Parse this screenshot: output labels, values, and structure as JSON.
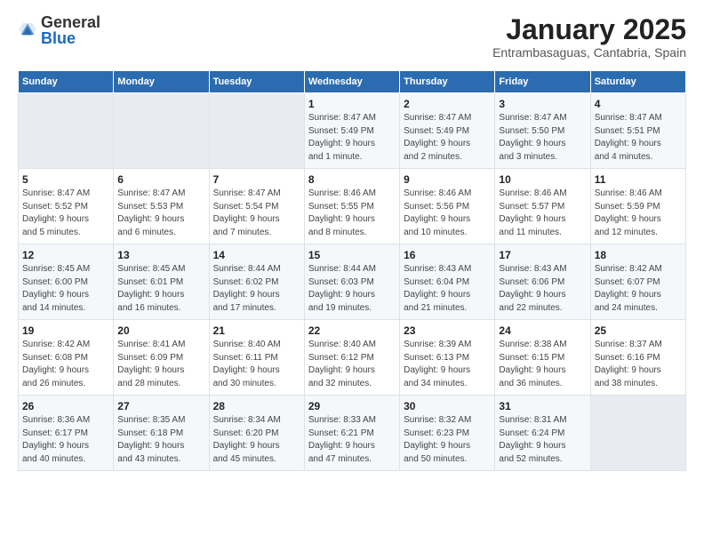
{
  "logo": {
    "general": "General",
    "blue": "Blue"
  },
  "title": "January 2025",
  "subtitle": "Entrambasaguas, Cantabria, Spain",
  "weekdays": [
    "Sunday",
    "Monday",
    "Tuesday",
    "Wednesday",
    "Thursday",
    "Friday",
    "Saturday"
  ],
  "weeks": [
    [
      {
        "day": "",
        "empty": true
      },
      {
        "day": "",
        "empty": true
      },
      {
        "day": "",
        "empty": true
      },
      {
        "day": "1",
        "lines": [
          "Sunrise: 8:47 AM",
          "Sunset: 5:49 PM",
          "Daylight: 9 hours",
          "and 1 minute."
        ]
      },
      {
        "day": "2",
        "lines": [
          "Sunrise: 8:47 AM",
          "Sunset: 5:49 PM",
          "Daylight: 9 hours",
          "and 2 minutes."
        ]
      },
      {
        "day": "3",
        "lines": [
          "Sunrise: 8:47 AM",
          "Sunset: 5:50 PM",
          "Daylight: 9 hours",
          "and 3 minutes."
        ]
      },
      {
        "day": "4",
        "lines": [
          "Sunrise: 8:47 AM",
          "Sunset: 5:51 PM",
          "Daylight: 9 hours",
          "and 4 minutes."
        ]
      }
    ],
    [
      {
        "day": "5",
        "lines": [
          "Sunrise: 8:47 AM",
          "Sunset: 5:52 PM",
          "Daylight: 9 hours",
          "and 5 minutes."
        ]
      },
      {
        "day": "6",
        "lines": [
          "Sunrise: 8:47 AM",
          "Sunset: 5:53 PM",
          "Daylight: 9 hours",
          "and 6 minutes."
        ]
      },
      {
        "day": "7",
        "lines": [
          "Sunrise: 8:47 AM",
          "Sunset: 5:54 PM",
          "Daylight: 9 hours",
          "and 7 minutes."
        ]
      },
      {
        "day": "8",
        "lines": [
          "Sunrise: 8:46 AM",
          "Sunset: 5:55 PM",
          "Daylight: 9 hours",
          "and 8 minutes."
        ]
      },
      {
        "day": "9",
        "lines": [
          "Sunrise: 8:46 AM",
          "Sunset: 5:56 PM",
          "Daylight: 9 hours",
          "and 10 minutes."
        ]
      },
      {
        "day": "10",
        "lines": [
          "Sunrise: 8:46 AM",
          "Sunset: 5:57 PM",
          "Daylight: 9 hours",
          "and 11 minutes."
        ]
      },
      {
        "day": "11",
        "lines": [
          "Sunrise: 8:46 AM",
          "Sunset: 5:59 PM",
          "Daylight: 9 hours",
          "and 12 minutes."
        ]
      }
    ],
    [
      {
        "day": "12",
        "lines": [
          "Sunrise: 8:45 AM",
          "Sunset: 6:00 PM",
          "Daylight: 9 hours",
          "and 14 minutes."
        ]
      },
      {
        "day": "13",
        "lines": [
          "Sunrise: 8:45 AM",
          "Sunset: 6:01 PM",
          "Daylight: 9 hours",
          "and 16 minutes."
        ]
      },
      {
        "day": "14",
        "lines": [
          "Sunrise: 8:44 AM",
          "Sunset: 6:02 PM",
          "Daylight: 9 hours",
          "and 17 minutes."
        ]
      },
      {
        "day": "15",
        "lines": [
          "Sunrise: 8:44 AM",
          "Sunset: 6:03 PM",
          "Daylight: 9 hours",
          "and 19 minutes."
        ]
      },
      {
        "day": "16",
        "lines": [
          "Sunrise: 8:43 AM",
          "Sunset: 6:04 PM",
          "Daylight: 9 hours",
          "and 21 minutes."
        ]
      },
      {
        "day": "17",
        "lines": [
          "Sunrise: 8:43 AM",
          "Sunset: 6:06 PM",
          "Daylight: 9 hours",
          "and 22 minutes."
        ]
      },
      {
        "day": "18",
        "lines": [
          "Sunrise: 8:42 AM",
          "Sunset: 6:07 PM",
          "Daylight: 9 hours",
          "and 24 minutes."
        ]
      }
    ],
    [
      {
        "day": "19",
        "lines": [
          "Sunrise: 8:42 AM",
          "Sunset: 6:08 PM",
          "Daylight: 9 hours",
          "and 26 minutes."
        ]
      },
      {
        "day": "20",
        "lines": [
          "Sunrise: 8:41 AM",
          "Sunset: 6:09 PM",
          "Daylight: 9 hours",
          "and 28 minutes."
        ]
      },
      {
        "day": "21",
        "lines": [
          "Sunrise: 8:40 AM",
          "Sunset: 6:11 PM",
          "Daylight: 9 hours",
          "and 30 minutes."
        ]
      },
      {
        "day": "22",
        "lines": [
          "Sunrise: 8:40 AM",
          "Sunset: 6:12 PM",
          "Daylight: 9 hours",
          "and 32 minutes."
        ]
      },
      {
        "day": "23",
        "lines": [
          "Sunrise: 8:39 AM",
          "Sunset: 6:13 PM",
          "Daylight: 9 hours",
          "and 34 minutes."
        ]
      },
      {
        "day": "24",
        "lines": [
          "Sunrise: 8:38 AM",
          "Sunset: 6:15 PM",
          "Daylight: 9 hours",
          "and 36 minutes."
        ]
      },
      {
        "day": "25",
        "lines": [
          "Sunrise: 8:37 AM",
          "Sunset: 6:16 PM",
          "Daylight: 9 hours",
          "and 38 minutes."
        ]
      }
    ],
    [
      {
        "day": "26",
        "lines": [
          "Sunrise: 8:36 AM",
          "Sunset: 6:17 PM",
          "Daylight: 9 hours",
          "and 40 minutes."
        ]
      },
      {
        "day": "27",
        "lines": [
          "Sunrise: 8:35 AM",
          "Sunset: 6:18 PM",
          "Daylight: 9 hours",
          "and 43 minutes."
        ]
      },
      {
        "day": "28",
        "lines": [
          "Sunrise: 8:34 AM",
          "Sunset: 6:20 PM",
          "Daylight: 9 hours",
          "and 45 minutes."
        ]
      },
      {
        "day": "29",
        "lines": [
          "Sunrise: 8:33 AM",
          "Sunset: 6:21 PM",
          "Daylight: 9 hours",
          "and 47 minutes."
        ]
      },
      {
        "day": "30",
        "lines": [
          "Sunrise: 8:32 AM",
          "Sunset: 6:23 PM",
          "Daylight: 9 hours",
          "and 50 minutes."
        ]
      },
      {
        "day": "31",
        "lines": [
          "Sunrise: 8:31 AM",
          "Sunset: 6:24 PM",
          "Daylight: 9 hours",
          "and 52 minutes."
        ]
      },
      {
        "day": "",
        "empty": true
      }
    ]
  ]
}
